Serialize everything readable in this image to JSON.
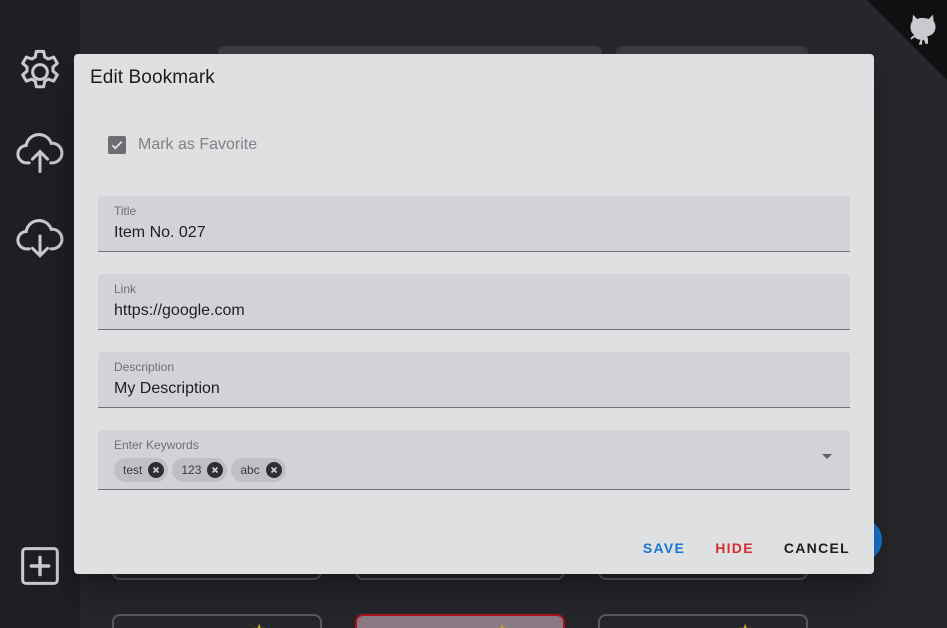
{
  "dialog": {
    "title": "Edit Bookmark",
    "favorite": {
      "label": "Mark as Favorite",
      "checked": true
    },
    "fields": {
      "title": {
        "label": "Title",
        "value": "Item No. 027"
      },
      "link": {
        "label": "Link",
        "value": "https://google.com"
      },
      "description": {
        "label": "Description",
        "value": "My Description"
      },
      "keywords": {
        "label": "Enter Keywords",
        "chips": [
          "test",
          "123",
          "abc"
        ]
      }
    },
    "actions": {
      "save": "SAVE",
      "hide": "HIDE",
      "cancel": "CANCEL"
    }
  },
  "sidebar": {
    "icons": [
      "settings-icon",
      "cloud-upload-icon",
      "cloud-download-icon",
      "add-box-icon"
    ]
  },
  "colors": {
    "save": "#1976d2",
    "hide": "#d32f2f",
    "cancel": "#1d1d1d",
    "dialog_bg": "#dfe0e2",
    "sidebar_bg": "#1e1f22"
  }
}
